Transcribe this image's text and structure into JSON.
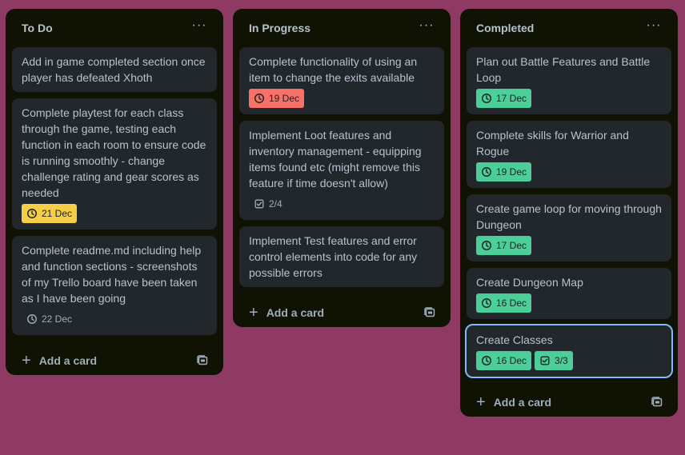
{
  "lists": [
    {
      "title": "To Do",
      "cards": [
        {
          "text": "Add in game completed section once player has defeated Xhoth"
        },
        {
          "text": "Complete playtest for each class through the game, testing each function in each room to ensure code is running smoothly - change challenge rating and gear scores as needed",
          "date": "21 Dec",
          "date_color": "#f5cd47"
        },
        {
          "text": "Complete readme.md including help and function sections - screenshots of my Trello board have been taken as I have been going",
          "date": "22 Dec"
        }
      ],
      "add_label": "Add a card"
    },
    {
      "title": "In Progress",
      "cards": [
        {
          "text": "Complete functionality of using an item to change the exits available",
          "date": "19 Dec",
          "date_color": "#f87168"
        },
        {
          "text": "Implement Loot features and inventory management - equipping items found etc (might remove this feature if time doesn't allow)",
          "checklist": "2/4"
        },
        {
          "text": "Implement Test features and error control elements into code for any possible errors"
        }
      ],
      "add_label": "Add a card"
    },
    {
      "title": "Completed",
      "cards": [
        {
          "text": "Plan out Battle Features and Battle Loop",
          "date": "17 Dec",
          "date_color": "#4bce97"
        },
        {
          "text": "Complete skills for Warrior and Rogue",
          "date": "19 Dec",
          "date_color": "#4bce97"
        },
        {
          "text": "Create game loop for moving through Dungeon",
          "date": "17 Dec",
          "date_color": "#4bce97"
        },
        {
          "text": "Create Dungeon Map",
          "date": "16 Dec",
          "date_color": "#4bce97"
        },
        {
          "text": "Create Classes",
          "date": "16 Dec",
          "date_color": "#4bce97",
          "checklist": "3/3",
          "checklist_color": "#4bce97"
        }
      ],
      "add_label": "Add a card"
    }
  ],
  "icons": {
    "list_menu": "more-horizontal-icon",
    "date": "clock-icon",
    "checklist": "checkbox-icon",
    "add": "plus-icon",
    "template": "card-template-icon"
  },
  "colors": {
    "board_background": "#8f3a62",
    "list_background": "#101204",
    "card_background": "#22272b",
    "focus_outline": "#85b8ff"
  }
}
